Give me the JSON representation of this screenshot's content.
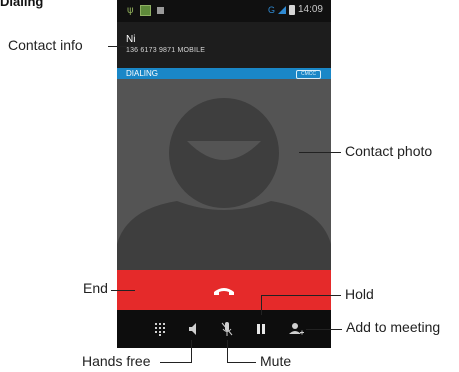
{
  "section_title": "Dialing",
  "status_bar": {
    "network": "G",
    "time": "14:09",
    "icons": [
      "usb-icon",
      "image-icon",
      "notification-icon",
      "signal-icon",
      "battery-icon"
    ]
  },
  "contact": {
    "name": "Ni",
    "number_line": "136 6173 9871  MOBILE"
  },
  "call": {
    "status": "DIALING",
    "carrier": "CMCC"
  },
  "controls": {
    "icons": [
      "dialpad-icon",
      "speaker-icon",
      "mute-mic-icon",
      "hold-pause-icon",
      "add-person-icon"
    ]
  },
  "annotations": {
    "contact_info": "Contact info",
    "contact_photo": "Contact photo",
    "end": "End",
    "hold": "Hold",
    "add_to_meeting": "Add to meeting",
    "hands_free": "Hands free",
    "mute": "Mute"
  },
  "colors": {
    "dialing_bar": "#1a87c7",
    "end_area": "#e52a2a",
    "photo_bg": "#545454",
    "controls_bg": "#0d0d0d"
  }
}
